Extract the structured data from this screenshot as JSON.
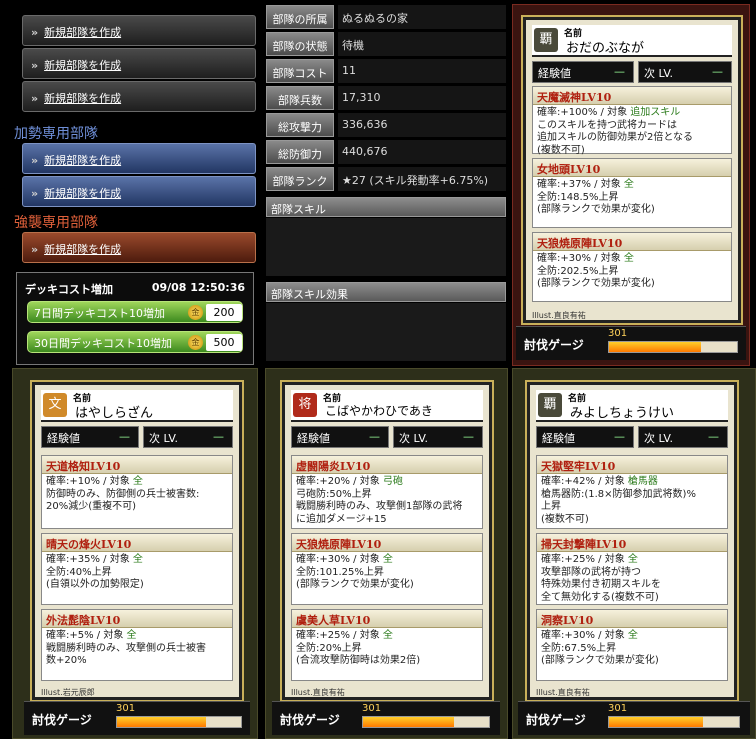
{
  "sidebar": {
    "new_label": "新規部隊を作成",
    "sections": {
      "support": "加勢専用部隊",
      "raid": "強襲専用部隊"
    }
  },
  "deck": {
    "title": "デッキコスト増加",
    "time": "09/08 12:50:36",
    "options": [
      {
        "label": "7日間デッキコスト10増加",
        "coin": "金",
        "price": "200"
      },
      {
        "label": "30日間デッキコスト10増加",
        "coin": "金",
        "price": "500"
      }
    ]
  },
  "info": {
    "rows": [
      {
        "label": "部隊の所属",
        "value": "ぬるぬるの家"
      },
      {
        "label": "部隊の状態",
        "value": "待機"
      },
      {
        "label": "部隊コスト",
        "value": "11"
      },
      {
        "label": "部隊兵数",
        "value": "17,310"
      },
      {
        "label": "総攻撃力",
        "value": "336,636"
      },
      {
        "label": "総防御力",
        "value": "440,676"
      },
      {
        "label": "部隊ランク",
        "value": "★27 (スキル発動率+6.75%)"
      }
    ],
    "skill_header": "部隊スキル",
    "effect_header": "部隊スキル効果"
  },
  "common": {
    "name_label": "名前",
    "exp_label": "経験値",
    "next_label": "次 LV.",
    "dash": "—",
    "gauge_label": "討伐ゲージ"
  },
  "cards": [
    {
      "icon": "覇",
      "name": "おだのぶなが",
      "illust": "Illust.直良有祐",
      "gauge": "301",
      "gauge_level": 0.72,
      "skills": [
        {
          "title": "天魔滅神LV10",
          "lines": [
            [
              "確率:+100% / 対象 ",
              "追加スキル"
            ],
            [
              "このスキルを持つ武将カードは",
              ""
            ],
            [
              "追加スキルの防御効果が2倍となる",
              ""
            ],
            [
              "(複数不可)",
              ""
            ]
          ]
        },
        {
          "title": "女地頭LV10",
          "lines": [
            [
              "確率:+37% / 対象 ",
              "全"
            ],
            [
              "全防:148.5%上昇",
              ""
            ],
            [
              "(部隊ランクで効果が変化)",
              ""
            ]
          ]
        },
        {
          "title": "天狼焼原陣LV10",
          "lines": [
            [
              "確率:+30% / 対象 ",
              "全"
            ],
            [
              "全防:202.5%上昇",
              ""
            ],
            [
              "(部隊ランクで効果が変化)",
              ""
            ]
          ]
        }
      ]
    },
    {
      "icon": "文",
      "name": "はやしらざん",
      "illust": "Illust.岩元辰郎",
      "gauge": "301",
      "gauge_level": 0.72,
      "skills": [
        {
          "title": "天道格知LV10",
          "lines": [
            [
              "確率:+10% / 対象 ",
              "全"
            ],
            [
              "防御時のみ、防御側の兵士被害数:",
              ""
            ],
            [
              "20%減少(重複不可)",
              ""
            ]
          ]
        },
        {
          "title": "晴天の烽火LV10",
          "lines": [
            [
              "確率:+35% / 対象 ",
              "全"
            ],
            [
              "全防:40%上昇",
              ""
            ],
            [
              "(自領以外の加勢限定)",
              ""
            ]
          ]
        },
        {
          "title": "外法髭陰LV10",
          "lines": [
            [
              "確率:+5% / 対象 ",
              "全"
            ],
            [
              "戦闘勝利時のみ、攻撃側の兵士被害",
              ""
            ],
            [
              "数+20%",
              ""
            ]
          ]
        }
      ]
    },
    {
      "icon": "将",
      "name": "こばやかわひであき",
      "illust": "Illust.直良有祐",
      "gauge": "301",
      "gauge_level": 0.72,
      "skills": [
        {
          "title": "虚闘陽炎LV10",
          "lines": [
            [
              "確率:+20% / 対象 ",
              "弓砲"
            ],
            [
              "弓砲防:50%上昇",
              ""
            ],
            [
              "戦闘勝利時のみ、攻撃側1部隊の武将",
              ""
            ],
            [
              "に追加ダメージ+15",
              ""
            ]
          ]
        },
        {
          "title": "天狼焼原陣LV10",
          "lines": [
            [
              "確率:+30% / 対象 ",
              "全"
            ],
            [
              "全防:101.25%上昇",
              ""
            ],
            [
              "(部隊ランクで効果が変化)",
              ""
            ]
          ]
        },
        {
          "title": "虞美人草LV10",
          "lines": [
            [
              "確率:+25% / 対象 ",
              "全"
            ],
            [
              "全防:20%上昇",
              ""
            ],
            [
              "(合流攻撃防御時は効果2倍)",
              ""
            ]
          ]
        }
      ]
    },
    {
      "icon": "覇",
      "name": "みよしちょうけい",
      "illust": "Illust.直良有祐",
      "gauge": "301",
      "gauge_level": 0.72,
      "skills": [
        {
          "title": "天獄堅牢LV10",
          "lines": [
            [
              "確率:+42% / 対象 ",
              "槍馬器"
            ],
            [
              "槍馬器防:(1.8×防御参加武将数)%",
              ""
            ],
            [
              "上昇",
              ""
            ],
            [
              "(複数不可)",
              ""
            ]
          ]
        },
        {
          "title": "掃天封撃陣LV10",
          "lines": [
            [
              "確率:+25% / 対象 ",
              "全"
            ],
            [
              "攻撃部隊の武将が持つ",
              ""
            ],
            [
              "特殊効果付き初期スキルを",
              ""
            ],
            [
              "全て無効化する(複数不可)",
              ""
            ]
          ]
        },
        {
          "title": "洞察LV10",
          "lines": [
            [
              "確率:+30% / 対象 ",
              "全"
            ],
            [
              "全防:67.5%上昇",
              ""
            ],
            [
              "(部隊ランクで効果が変化)",
              ""
            ]
          ]
        }
      ]
    }
  ]
}
